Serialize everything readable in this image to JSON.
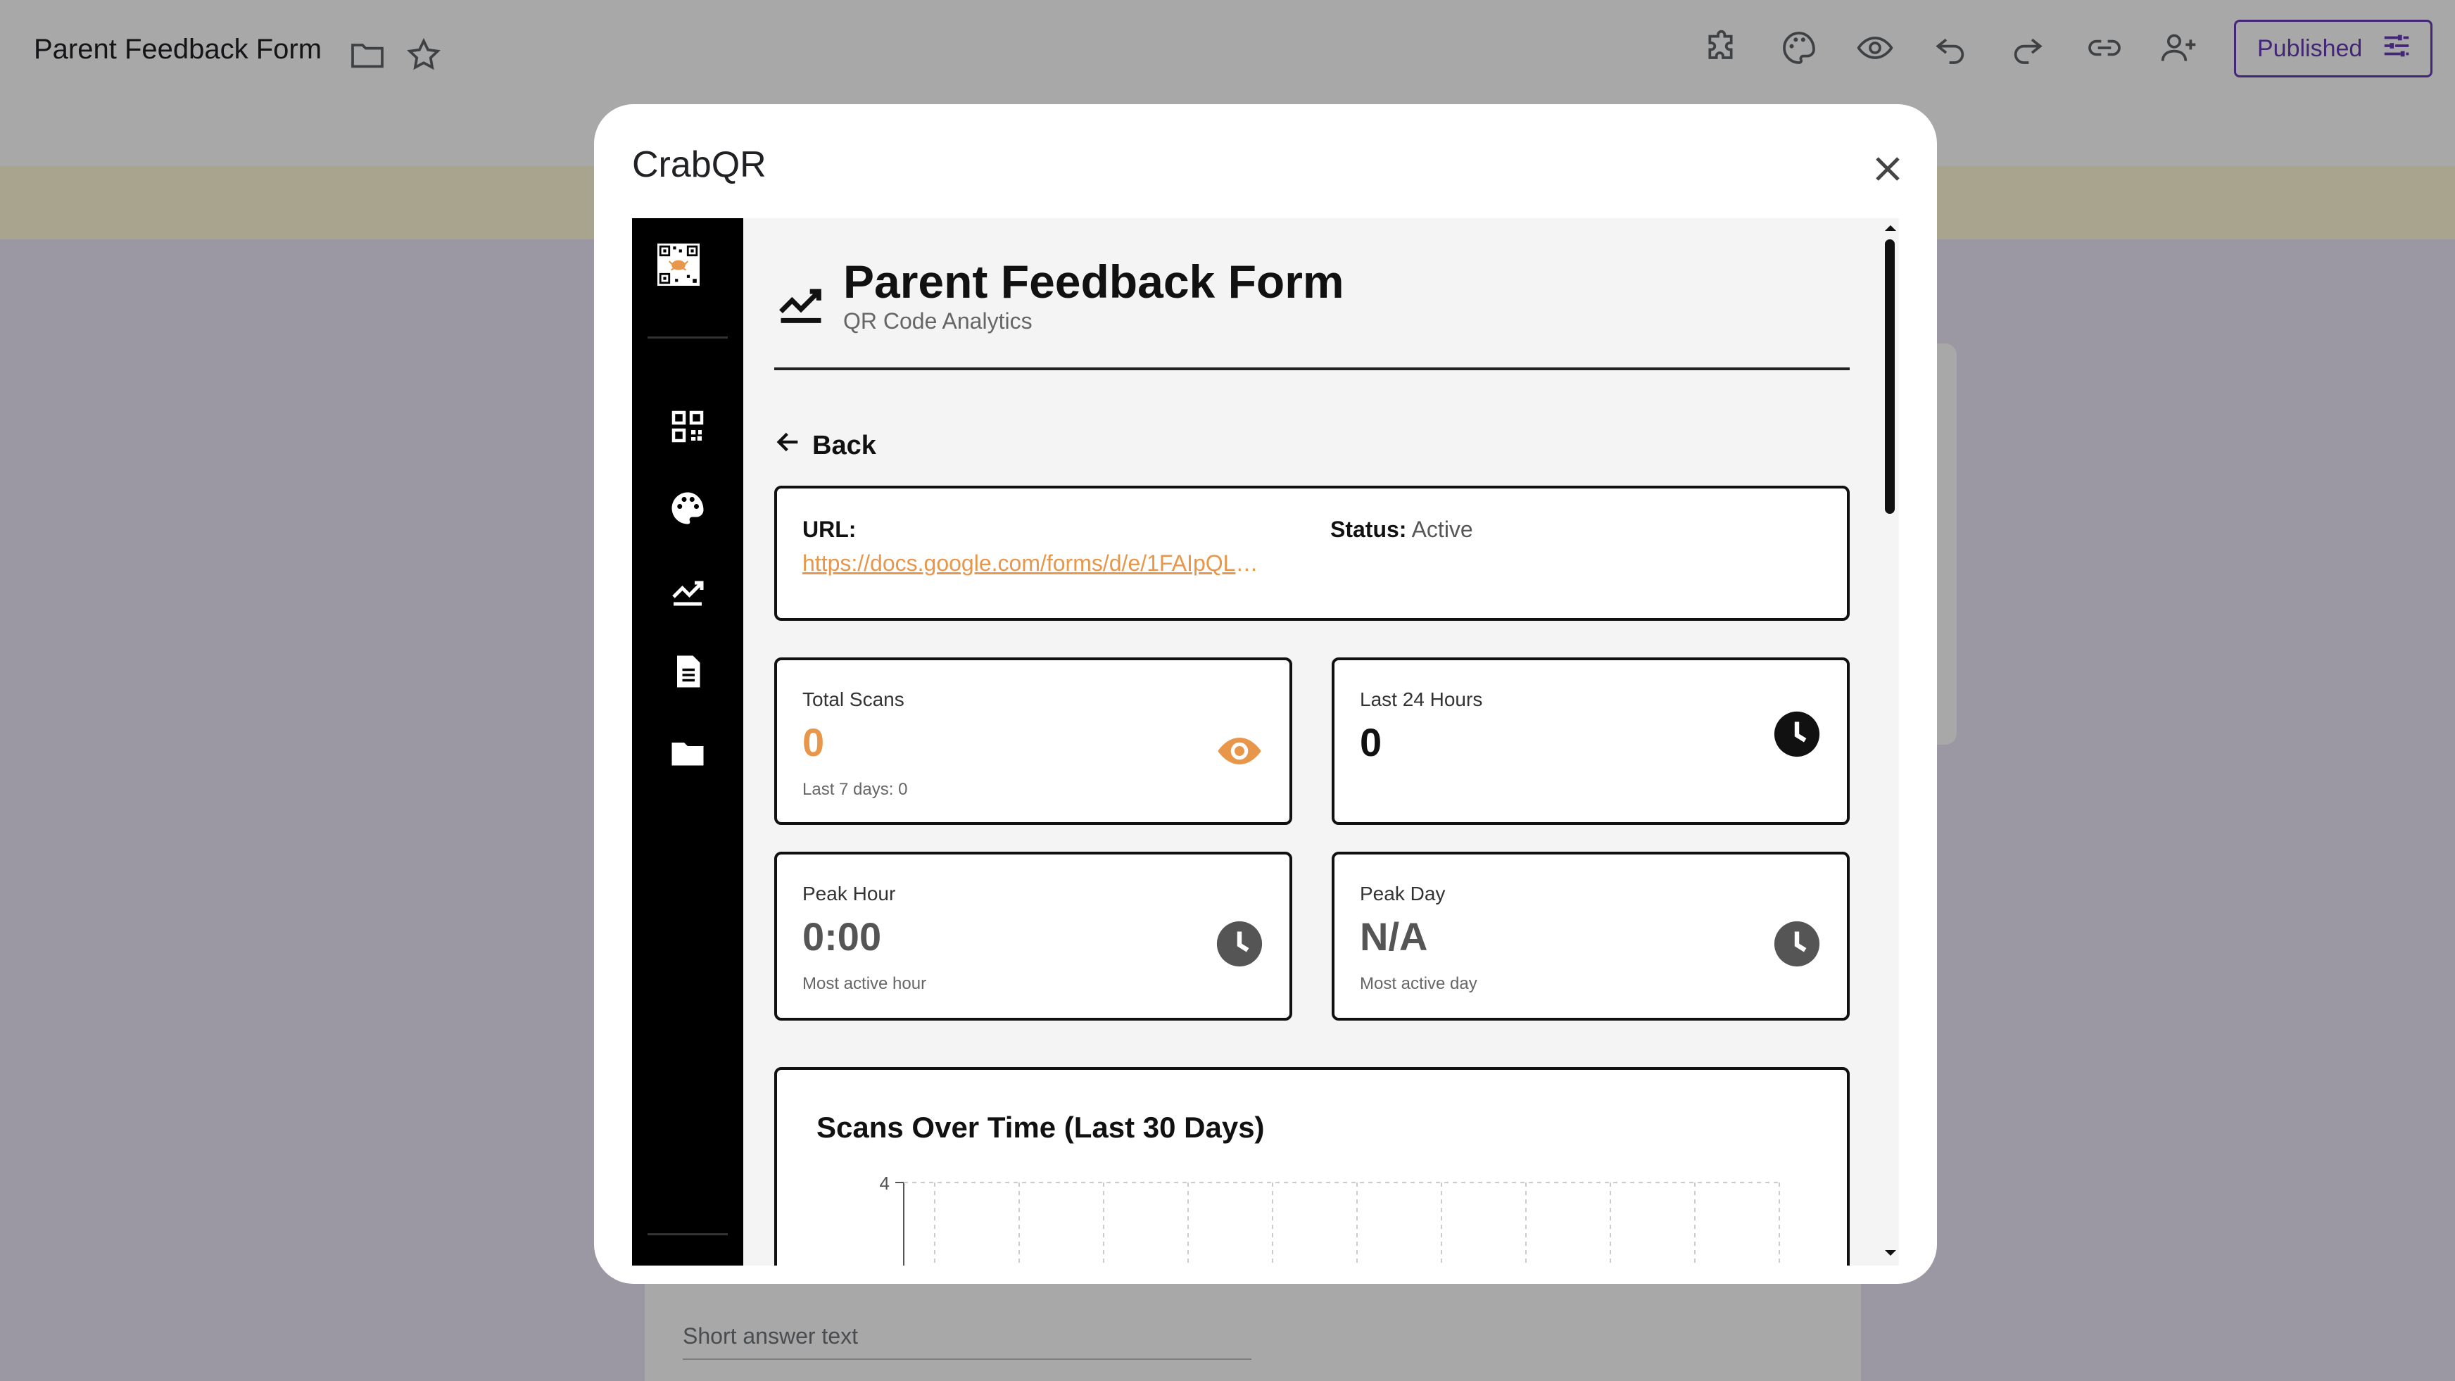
{
  "forms_header": {
    "title": "Parent Feedback Form",
    "published_label": "Published"
  },
  "forms_body": {
    "short_answer_placeholder": "Short answer text"
  },
  "modal": {
    "title": "CrabQR"
  },
  "crabqr": {
    "sidebar": {
      "items": [
        {
          "icon": "qr-code-icon"
        },
        {
          "icon": "palette-icon"
        },
        {
          "icon": "analytics-icon"
        },
        {
          "icon": "document-icon"
        },
        {
          "icon": "folder-icon"
        }
      ],
      "footer_icon": "user-icon"
    },
    "page": {
      "title": "Parent Feedback Form",
      "subtitle": "QR Code Analytics",
      "back_label": "Back"
    },
    "info": {
      "url_label": "URL:",
      "url": "https://docs.google.com/forms/d/e/1FAIpQLS...",
      "status_label": "Status:",
      "status_value": "Active"
    },
    "stats": [
      {
        "label": "Total Scans",
        "value": "0",
        "sub": "Last 7 days: 0",
        "icon": "eye-icon",
        "color": "#e8964a"
      },
      {
        "label": "Last 24 Hours",
        "value": "0",
        "sub": "",
        "icon": "clock-icon",
        "color": "#111111"
      },
      {
        "label": "Peak Hour",
        "value": "0:00",
        "sub": "Most active hour",
        "icon": "clock-icon",
        "color": "#555555"
      },
      {
        "label": "Peak Day",
        "value": "N/A",
        "sub": "Most active day",
        "icon": "clock-icon",
        "color": "#555555"
      }
    ],
    "chart": {
      "title": "Scans Over Time (Last 30 Days)"
    }
  },
  "chart_data": {
    "type": "line",
    "title": "Scans Over Time (Last 30 Days)",
    "ylim": [
      0,
      4
    ],
    "y_tick_labels": [
      "4"
    ],
    "grid": true,
    "series": []
  },
  "colors": {
    "accent": "#e8964a",
    "forms_purple": "#673ab7"
  }
}
